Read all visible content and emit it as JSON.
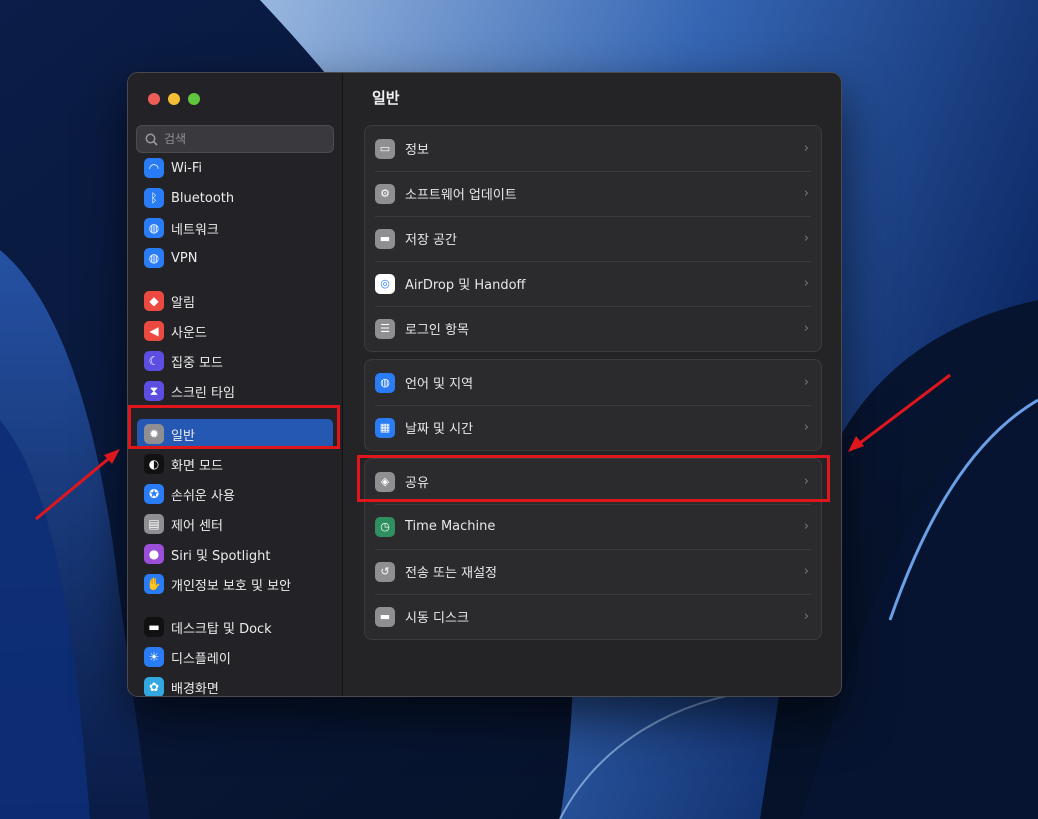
{
  "search": {
    "placeholder": "검색"
  },
  "sidebar": {
    "items": [
      {
        "label": "Wi-Fi",
        "icon": "wifi-icon",
        "color": "#2a7cf5"
      },
      {
        "label": "Bluetooth",
        "icon": "bluetooth-icon",
        "color": "#2a7cf5"
      },
      {
        "label": "네트워크",
        "icon": "globe-icon",
        "color": "#2a7cf5"
      },
      {
        "label": "VPN",
        "icon": "globe-icon",
        "color": "#2a7cf5"
      },
      {
        "label": "알림",
        "icon": "bell-icon",
        "color": "#ec4a41"
      },
      {
        "label": "사운드",
        "icon": "speaker-icon",
        "color": "#ec4a41"
      },
      {
        "label": "집중 모드",
        "icon": "moon-icon",
        "color": "#5b4ee0"
      },
      {
        "label": "스크린 타임",
        "icon": "hourglass-icon",
        "color": "#5b4ee0"
      },
      {
        "label": "일반",
        "icon": "gear-icon",
        "color": "#8e8e93"
      },
      {
        "label": "화면 모드",
        "icon": "appearance-icon",
        "color": "#111111"
      },
      {
        "label": "손쉬운 사용",
        "icon": "accessibility-icon",
        "color": "#2a7cf5"
      },
      {
        "label": "제어 센터",
        "icon": "control-center-icon",
        "color": "#8e8e93"
      },
      {
        "label": "Siri 및 Spotlight",
        "icon": "siri-icon",
        "color": "#9b4fd8"
      },
      {
        "label": "개인정보 보호 및 보안",
        "icon": "hand-icon",
        "color": "#2a7cf5"
      },
      {
        "label": "데스크탑 및 Dock",
        "icon": "dock-icon",
        "color": "#111111"
      },
      {
        "label": "디스플레이",
        "icon": "sun-icon",
        "color": "#2a7cf5"
      },
      {
        "label": "배경화면",
        "icon": "flower-icon",
        "color": "#33a8e0"
      }
    ]
  },
  "main": {
    "title": "일반",
    "groups": [
      [
        {
          "label": "정보",
          "icon": "laptop-icon",
          "color": "#8e8e93"
        },
        {
          "label": "소프트웨어 업데이트",
          "icon": "gear-badge-icon",
          "color": "#8e8e93"
        },
        {
          "label": "저장 공간",
          "icon": "drive-icon",
          "color": "#8e8e93"
        },
        {
          "label": "AirDrop 및 Handoff",
          "icon": "airdrop-icon",
          "color": "#ffffff"
        },
        {
          "label": "로그인 항목",
          "icon": "list-icon",
          "color": "#8e8e93"
        }
      ],
      [
        {
          "label": "언어 및 지역",
          "icon": "globe-icon",
          "color": "#2a7cf5"
        },
        {
          "label": "날짜 및 시간",
          "icon": "calendar-clock-icon",
          "color": "#2a7cf5"
        }
      ],
      [
        {
          "label": "공유",
          "icon": "share-icon",
          "color": "#8e8e93"
        },
        {
          "label": "Time Machine",
          "icon": "time-machine-icon",
          "color": "#2f8f5f"
        },
        {
          "label": "전송 또는 재설정",
          "icon": "reset-icon",
          "color": "#8e8e93"
        },
        {
          "label": "시동 디스크",
          "icon": "disk-icon",
          "color": "#8e8e93"
        }
      ]
    ]
  },
  "colors": {
    "accent": "#2458b3",
    "highlight": "#e0161d"
  }
}
